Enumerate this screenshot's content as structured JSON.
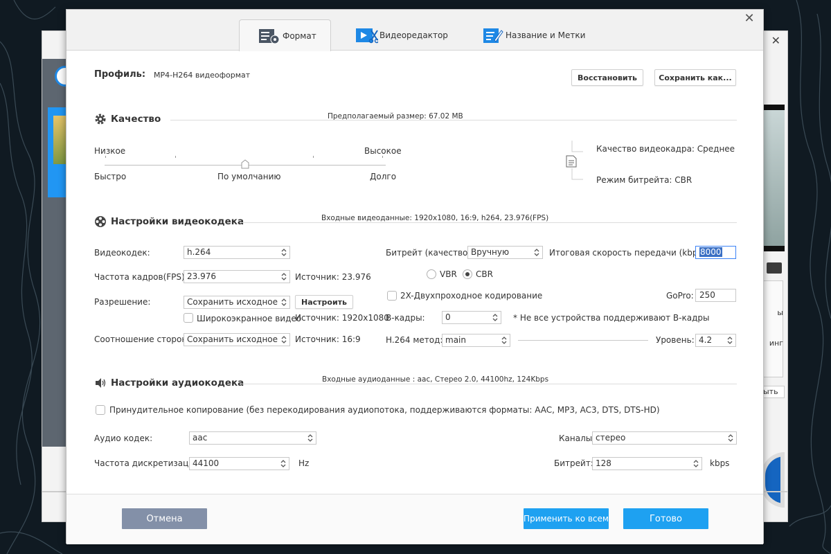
{
  "dialog": {
    "tabs": [
      {
        "label": "Формат",
        "icon": "format-icon",
        "active": true
      },
      {
        "label": "Видеоредактор",
        "icon": "video-editor-icon",
        "active": false
      },
      {
        "label": "Название и Метки",
        "icon": "title-tags-icon",
        "active": false
      }
    ],
    "close_symbol": "✕"
  },
  "profile": {
    "label": "Профиль:",
    "value": "MP4-H264 видеоформат",
    "restore_button": "Восстановить",
    "save_as_button": "Сохранить как..."
  },
  "quality": {
    "title": "Качество",
    "estimated_size": "Предполагаемый размер: 67.02 MB",
    "low_label": "Низкое",
    "high_label": "Высокое",
    "fast_label": "Быстро",
    "default_label": "По умолчанию",
    "slow_label": "Долго",
    "slider_value": 0.5,
    "frame_quality": "Качество видеокадра: Среднее",
    "bitrate_mode": "Режим битрейта: CBR"
  },
  "video": {
    "title": "Настройки видеокодека",
    "input_info": "Входные видеоданные: 1920x1080, 16:9, h264, 23.976(FPS)",
    "codec_label": "Видеокодек:",
    "codec_value": "h.264",
    "fps_label": "Частота кадров(FPS):",
    "fps_value": "23.976",
    "fps_source": "Источник: 23.976",
    "resolution_label": "Разрешение:",
    "resolution_value": "Сохранить исходное",
    "configure_button": "Настроить",
    "widescreen_label": "Широкоэкранное видео",
    "resolution_source": "Источник: 1920x1080",
    "aspect_label": "Соотношение сторон:",
    "aspect_value": "Сохранить исходное",
    "aspect_source": "Источник: 16:9",
    "bitrate_label": "Битрейт (качество):",
    "bitrate_value": "Вручную",
    "final_speed_label": "Итоговая скорость передачи (kbps):",
    "final_speed_value": "8000",
    "vbr_label": "VBR",
    "cbr_label": "CBR",
    "twopass_label": "2X-Двухпроходное кодирование",
    "gopro_label": "GoPro:",
    "gopro_value": "250",
    "bframes_label": "B-кадры:",
    "bframes_value": "0",
    "bframes_note": "* Не все устройства поддерживают B-кадры",
    "method_label": "H.264 метод:",
    "method_value": "main",
    "level_label": "Уровень:",
    "level_value": "4.2"
  },
  "audio": {
    "title": "Настройки аудиокодека",
    "input_info": "Входные аудиоданные : aac, Стерео 2.0, 44100hz, 124Kbps",
    "force_copy_label": "Принудительное копирование (без перекодирования аудиопотока, поддерживаются форматы: AAC, MP3, AC3, DTS, DTS-HD)",
    "codec_label": "Аудио кодек:",
    "codec_value": "aac",
    "samplerate_label": "Частота дискретизации:",
    "samplerate_value": "44100",
    "samplerate_unit": "Hz",
    "channels_label": "Каналы:",
    "channels_value": "стерео",
    "bitrate_label": "Битрейт:",
    "bitrate_value": "128",
    "bitrate_unit": "kbps"
  },
  "footer": {
    "cancel_button": "Отмена",
    "apply_all_button": "Применить ко всем",
    "done_button": "Готово"
  },
  "background": {
    "close_symbol": "✕",
    "right_text_1": "ы",
    "right_text_2": "инг",
    "right_button": "ыть"
  },
  "colors": {
    "accent": "#1ea1f1",
    "cancel": "#8390a8"
  }
}
